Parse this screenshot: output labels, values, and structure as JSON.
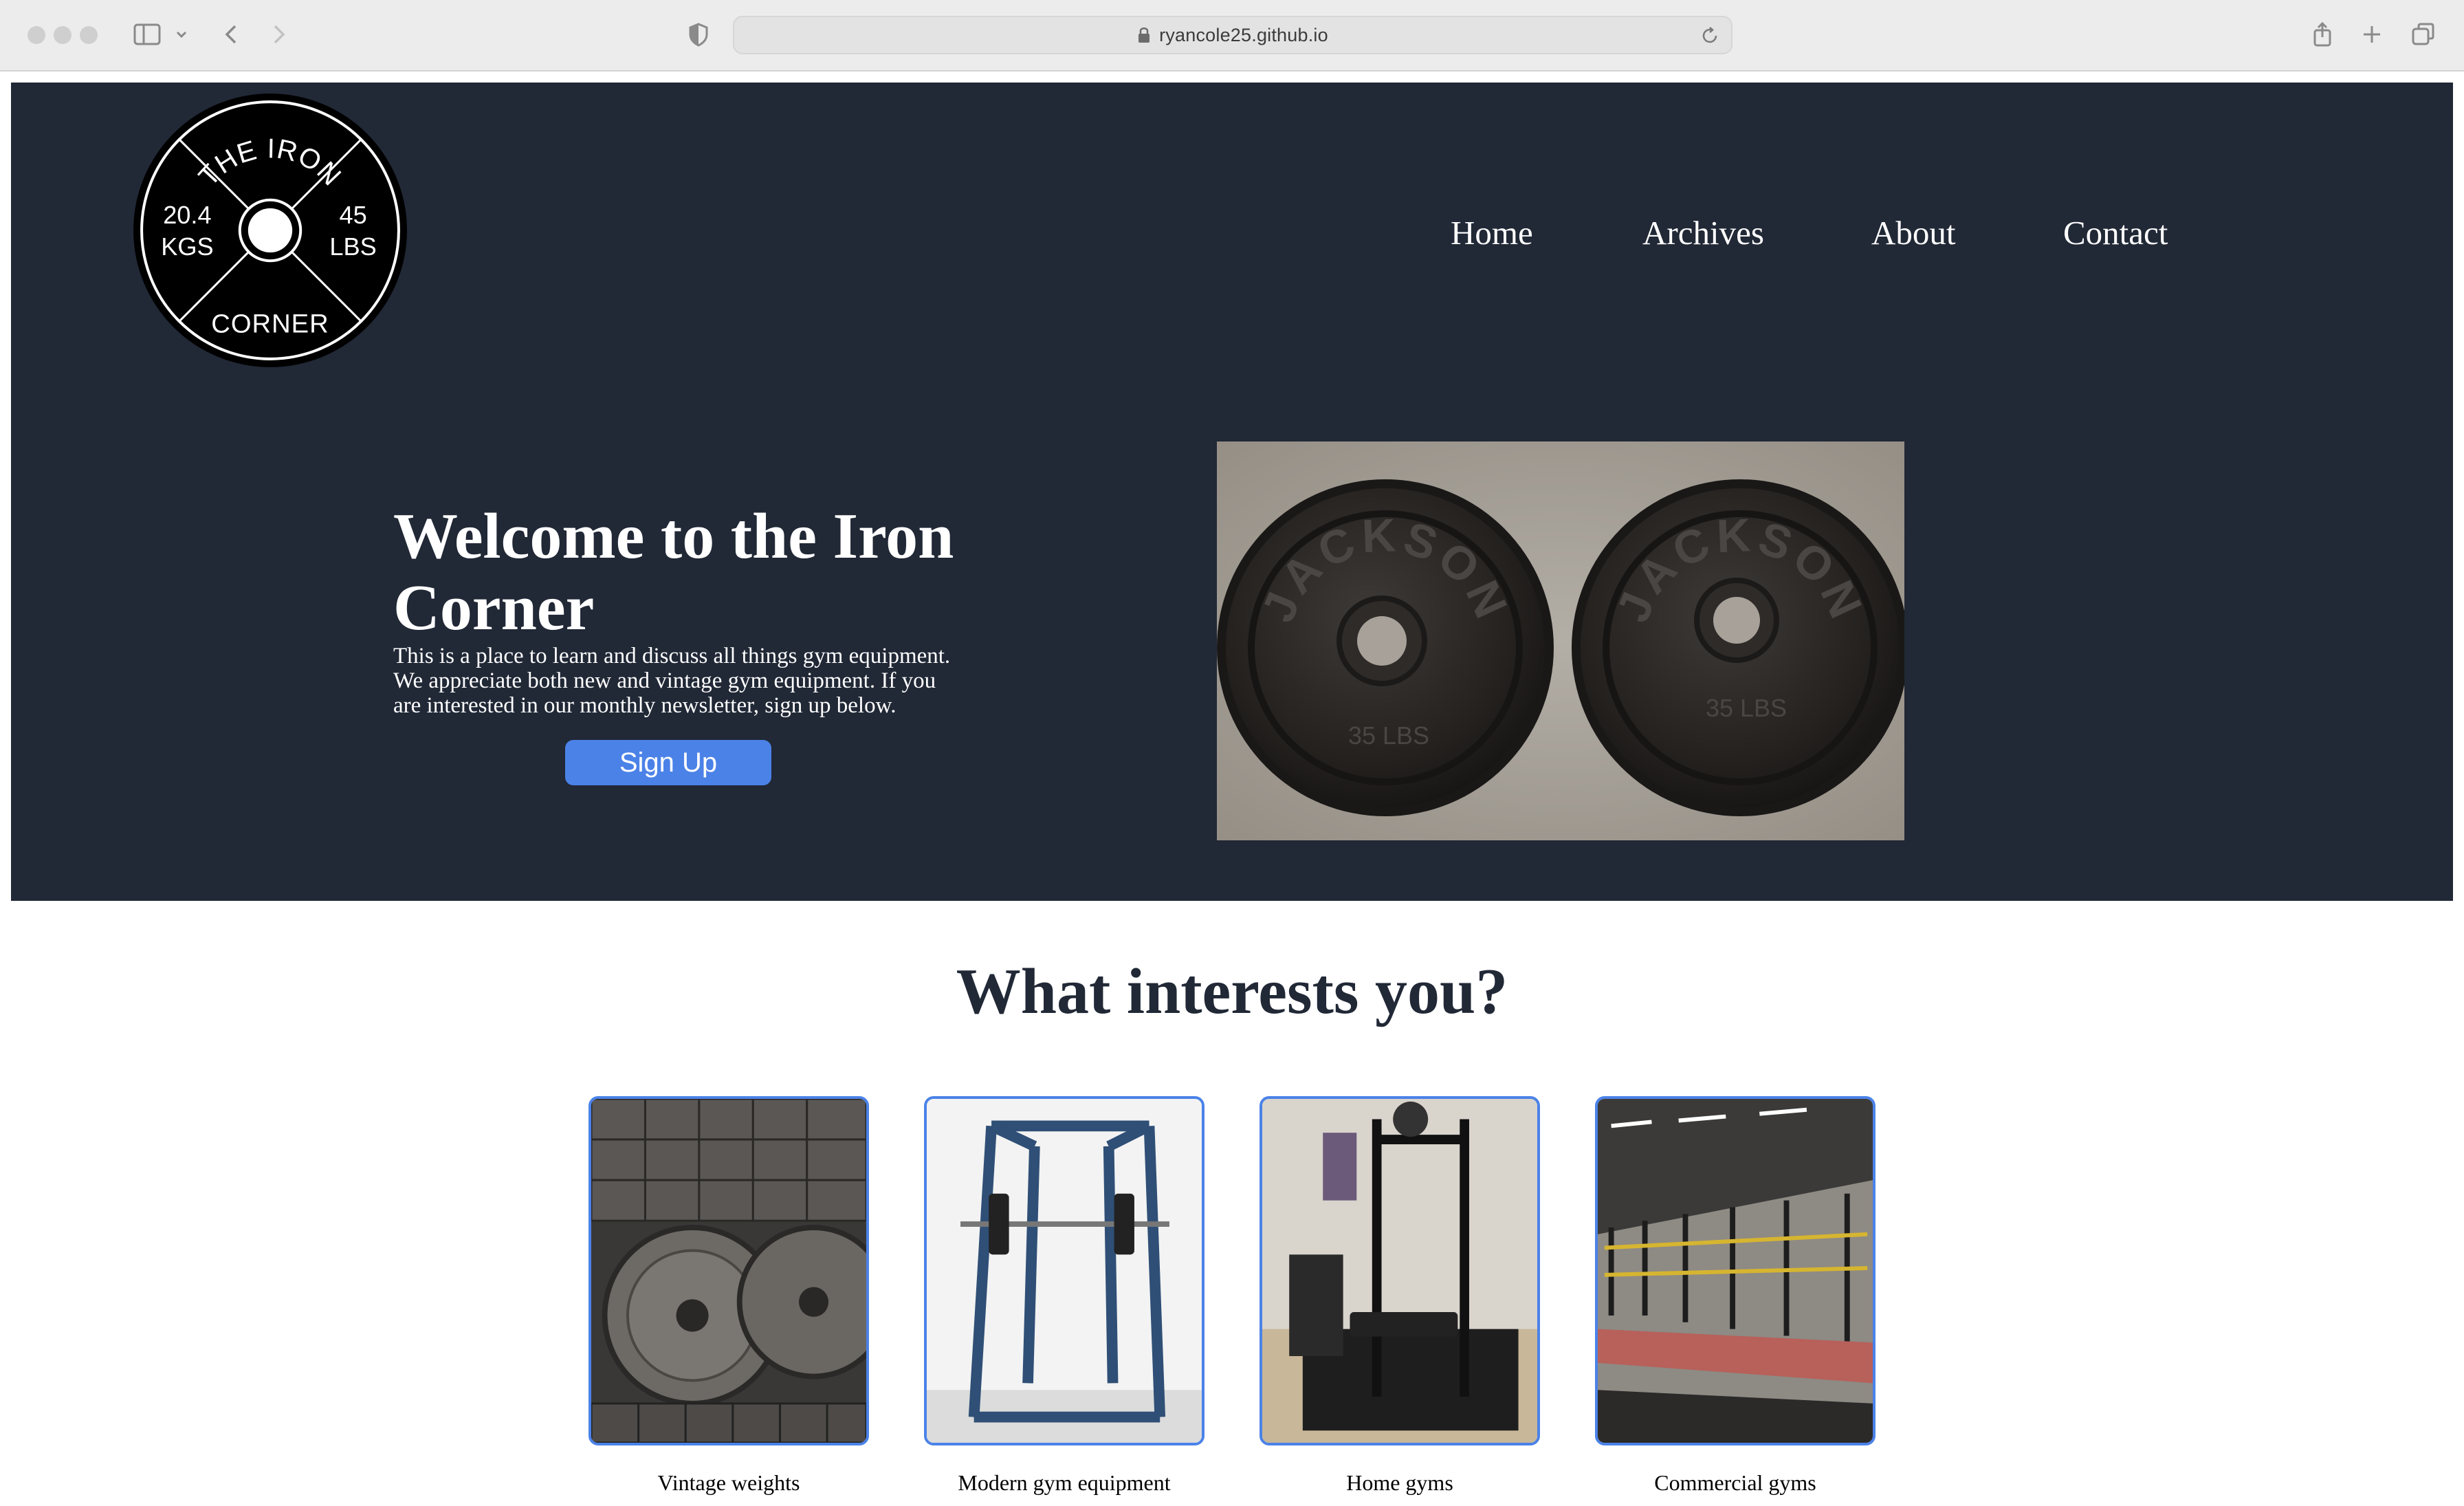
{
  "browser": {
    "url": "ryancole25.github.io"
  },
  "logo": {
    "top_text": "THE IRON",
    "bottom_text": "CORNER",
    "left_value": "20.4",
    "left_unit": "KGS",
    "right_value": "45",
    "right_unit": "LBS"
  },
  "nav": {
    "items": [
      {
        "label": "Home"
      },
      {
        "label": "Archives"
      },
      {
        "label": "About"
      },
      {
        "label": "Contact"
      }
    ]
  },
  "hero": {
    "title": "Welcome to the Iron Corner",
    "text": "This is a place to learn and discuss all things gym equipment. We appreciate both new and vintage gym equipment. If you are interested in our monthly newsletter, sign up below.",
    "button_label": "Sign Up",
    "photo_plate_text": "JACKSON",
    "photo_plate_weight": "35 LBS"
  },
  "interests": {
    "heading": "What interests you?",
    "cards": [
      {
        "label": "Vintage weights"
      },
      {
        "label": "Modern gym equipment"
      },
      {
        "label": "Home gyms"
      },
      {
        "label": "Commercial gyms"
      }
    ]
  },
  "colors": {
    "hero_background": "#212836",
    "accent": "#4b82e8",
    "heading_text": "#212836"
  }
}
